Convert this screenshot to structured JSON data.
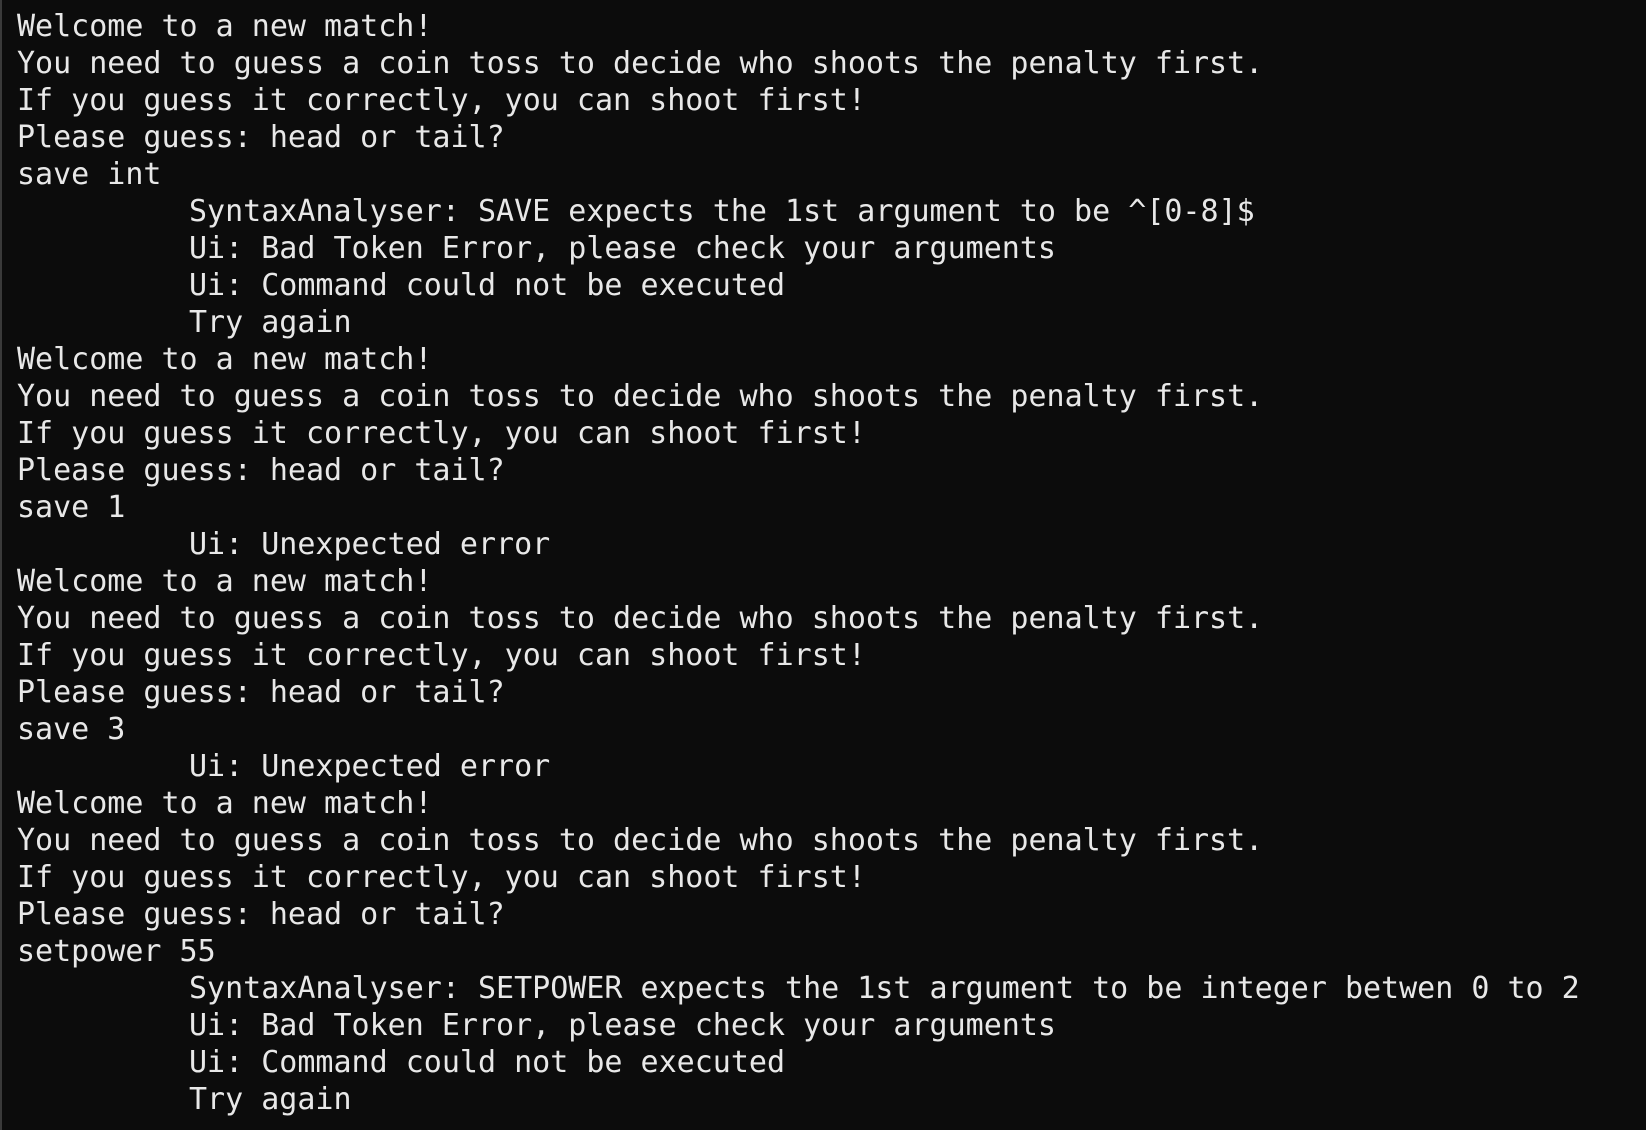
{
  "terminal": {
    "lines": [
      {
        "text": "Welcome to a new match!",
        "indent": false
      },
      {
        "text": "You need to guess a coin toss to decide who shoots the penalty first.",
        "indent": false
      },
      {
        "text": "If you guess it correctly, you can shoot first!",
        "indent": false
      },
      {
        "text": "Please guess: head or tail?",
        "indent": false
      },
      {
        "text": "save int",
        "indent": false
      },
      {
        "text": "SyntaxAnalyser: SAVE expects the 1st argument to be ^[0-8]$",
        "indent": true
      },
      {
        "text": "Ui: Bad Token Error, please check your arguments",
        "indent": true
      },
      {
        "text": "Ui: Command could not be executed",
        "indent": true
      },
      {
        "text": "Try again",
        "indent": true
      },
      {
        "text": "Welcome to a new match!",
        "indent": false
      },
      {
        "text": "You need to guess a coin toss to decide who shoots the penalty first.",
        "indent": false
      },
      {
        "text": "If you guess it correctly, you can shoot first!",
        "indent": false
      },
      {
        "text": "Please guess: head or tail?",
        "indent": false
      },
      {
        "text": "save 1",
        "indent": false
      },
      {
        "text": "Ui: Unexpected error",
        "indent": true
      },
      {
        "text": "Welcome to a new match!",
        "indent": false
      },
      {
        "text": "You need to guess a coin toss to decide who shoots the penalty first.",
        "indent": false
      },
      {
        "text": "If you guess it correctly, you can shoot first!",
        "indent": false
      },
      {
        "text": "Please guess: head or tail?",
        "indent": false
      },
      {
        "text": "save 3",
        "indent": false
      },
      {
        "text": "Ui: Unexpected error",
        "indent": true
      },
      {
        "text": "Welcome to a new match!",
        "indent": false
      },
      {
        "text": "You need to guess a coin toss to decide who shoots the penalty first.",
        "indent": false
      },
      {
        "text": "If you guess it correctly, you can shoot first!",
        "indent": false
      },
      {
        "text": "Please guess: head or tail?",
        "indent": false
      },
      {
        "text": "setpower 55",
        "indent": false
      },
      {
        "text": "SyntaxAnalyser: SETPOWER expects the 1st argument to be integer betwen 0 to 2",
        "indent": true
      },
      {
        "text": "Ui: Bad Token Error, please check your arguments",
        "indent": true
      },
      {
        "text": "Ui: Command could not be executed",
        "indent": true
      },
      {
        "text": "Try again",
        "indent": true
      }
    ]
  },
  "colors": {
    "background": "#0c0c0c",
    "text": "#e8e8e8"
  }
}
